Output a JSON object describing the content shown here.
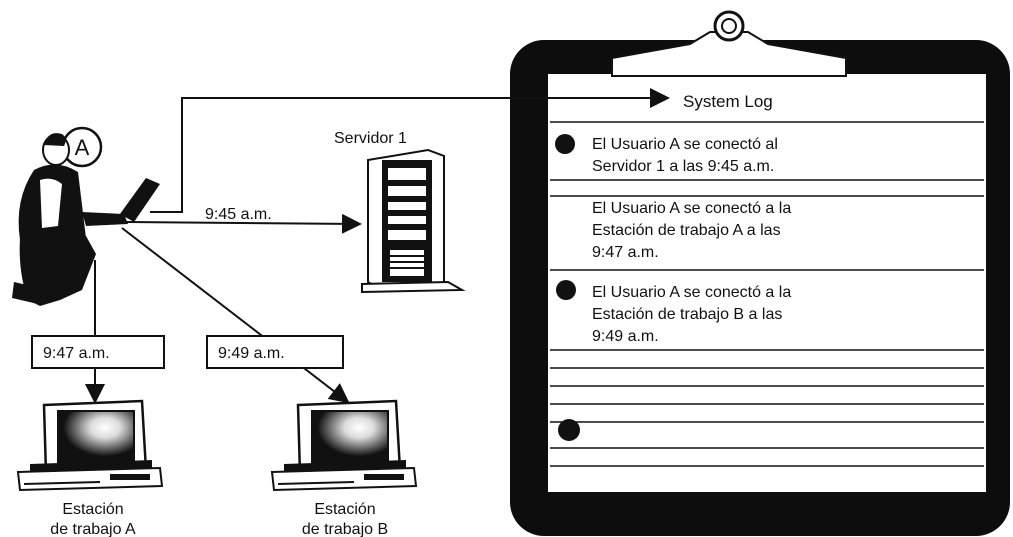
{
  "user_badge": "A",
  "server_label": "Servidor 1",
  "connections": {
    "to_server_time": "9:45 a.m.",
    "to_station_a_time": "9:47 a.m.",
    "to_station_b_time": "9:49 a.m."
  },
  "stations": {
    "a_line1": "Estación",
    "a_line2": "de trabajo A",
    "b_line1": "Estación",
    "b_line2": "de trabajo B"
  },
  "log": {
    "title": "System Log",
    "entries": [
      {
        "line1": "El Usuario A se conectó al",
        "line2": "Servidor 1 a las 9:45 a.m.",
        "line3": ""
      },
      {
        "line1": "El Usuario A se conectó a la",
        "line2": "Estación de trabajo A a las",
        "line3": "9:47 a.m."
      },
      {
        "line1": "El Usuario A se conectó a la",
        "line2": "Estación de trabajo B a las",
        "line3": "9:49 a.m."
      }
    ]
  },
  "colors": {
    "ink": "#111111",
    "paper": "#ffffff",
    "clipboard": "#0d0d0d"
  }
}
